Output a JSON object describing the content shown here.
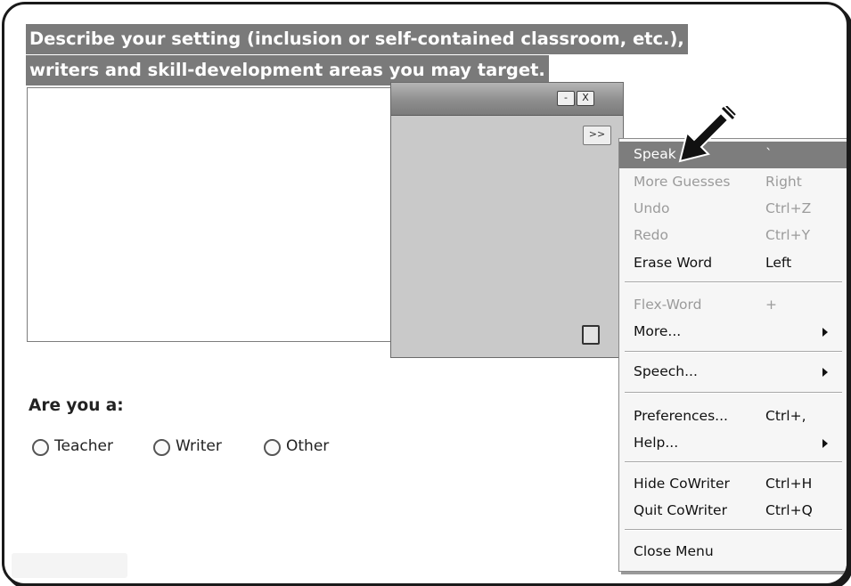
{
  "prompt": {
    "line1": "Describe your setting (inclusion or self-contained classroom, etc.),",
    "line2": "writers and skill-development areas you may target."
  },
  "cowriter_window": {
    "minimize_label": "-",
    "close_label": "X",
    "expand_label": ">>"
  },
  "context_menu": {
    "items": [
      {
        "label": "Speak",
        "shortcut": "`",
        "state": "highlighted"
      },
      {
        "label": "More Guesses",
        "shortcut": "Right",
        "state": "disabled"
      },
      {
        "label": "Undo",
        "shortcut": "Ctrl+Z",
        "state": "disabled"
      },
      {
        "label": "Redo",
        "shortcut": "Ctrl+Y",
        "state": "disabled"
      },
      {
        "label": "Erase Word",
        "shortcut": "Left",
        "state": "enabled"
      },
      {
        "label": "Flex-Word",
        "shortcut": "+",
        "state": "disabled"
      },
      {
        "label": "More...",
        "shortcut": "",
        "state": "submenu"
      },
      {
        "label": "Speech...",
        "shortcut": "",
        "state": "submenu"
      },
      {
        "label": "Preferences...",
        "shortcut": "Ctrl+,",
        "state": "enabled"
      },
      {
        "label": "Help...",
        "shortcut": "",
        "state": "submenu"
      },
      {
        "label": "Hide CoWriter",
        "shortcut": "Ctrl+H",
        "state": "enabled"
      },
      {
        "label": "Quit CoWriter",
        "shortcut": "Ctrl+Q",
        "state": "enabled"
      },
      {
        "label": "Close Menu",
        "shortcut": "",
        "state": "enabled"
      }
    ]
  },
  "role_question": {
    "title": "Are you a:",
    "options": [
      "Teacher",
      "Writer",
      "Other"
    ]
  },
  "colors": {
    "highlight": "#7d7d7d",
    "menu_bg": "#f6f6f6",
    "disabled_text": "#9b9b9b"
  }
}
